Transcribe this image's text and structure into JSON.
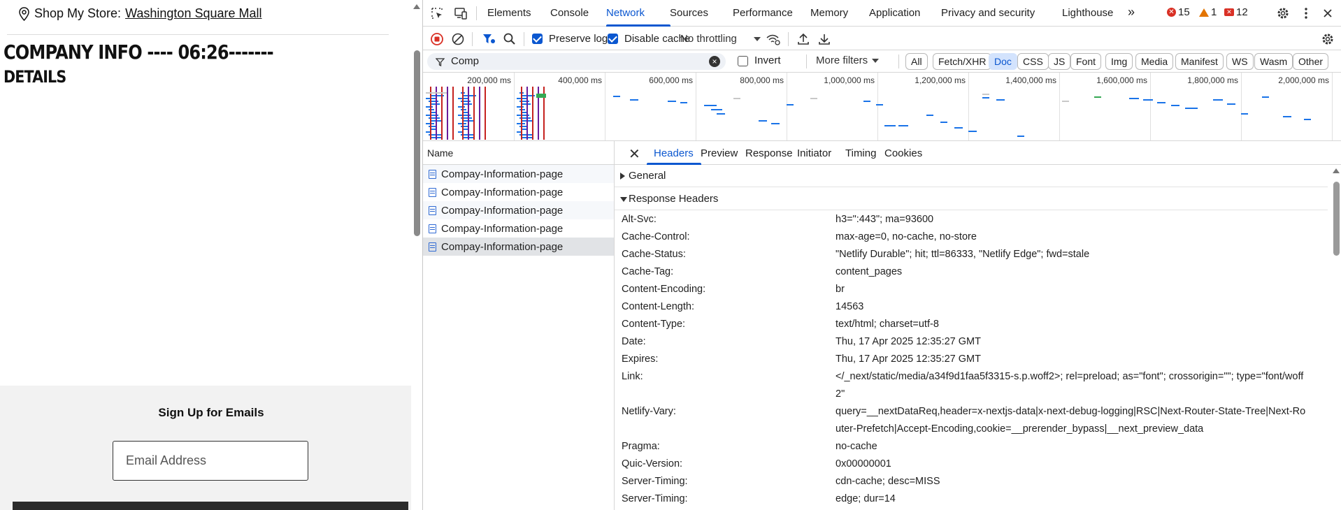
{
  "site": {
    "store_prefix": "Shop My Store: ",
    "store_name": "Washington Square Mall",
    "title": "COMPANY INFO ---- 06:26-------",
    "subtitle": "DETAILS",
    "signup_title": "Sign Up for Emails",
    "email_placeholder": "Email Address"
  },
  "devtools": {
    "tabs": [
      "Elements",
      "Console",
      "Network",
      "Sources",
      "Performance",
      "Memory",
      "Application",
      "Privacy and security",
      "Lighthouse"
    ],
    "active_tab": "Network",
    "more_tabs": "»",
    "errors": "15",
    "warnings": "1",
    "issues": "12",
    "toolbar": {
      "preserve_log": "Preserve log",
      "disable_cache": "Disable cache",
      "throttling": "No throttling"
    },
    "filter": {
      "value": "Comp",
      "invert": "Invert",
      "more_filters": "More filters",
      "types": [
        "All",
        "Fetch/XHR",
        "Doc",
        "CSS",
        "JS",
        "Font",
        "Img",
        "Media",
        "Manifest",
        "WS",
        "Wasm",
        "Other"
      ],
      "active_type": "Doc"
    },
    "overview_ticks": [
      "200,000 ms",
      "400,000 ms",
      "600,000 ms",
      "800,000 ms",
      "1,000,000 ms",
      "1,200,000 ms",
      "1,400,000 ms",
      "1,600,000 ms",
      "1,800,000 ms",
      "2,000,000 ms"
    ],
    "list": {
      "header": "Name",
      "rows": [
        "Compay-Information-page",
        "Compay-Information-page",
        "Compay-Information-page",
        "Compay-Information-page",
        "Compay-Information-page"
      ],
      "selected_index": 4
    },
    "detail": {
      "tabs": [
        "Headers",
        "Preview",
        "Response",
        "Initiator",
        "Timing",
        "Cookies"
      ],
      "active_tab": "Headers",
      "general": "General",
      "response_headers": "Response Headers",
      "headers": [
        {
          "name": "Alt-Svc:",
          "value": "h3=\":443\"; ma=93600"
        },
        {
          "name": "Cache-Control:",
          "value": "max-age=0, no-cache, no-store"
        },
        {
          "name": "Cache-Status:",
          "value": "\"Netlify Durable\"; hit; ttl=86333, \"Netlify Edge\"; fwd=stale"
        },
        {
          "name": "Cache-Tag:",
          "value": "content_pages"
        },
        {
          "name": "Content-Encoding:",
          "value": "br"
        },
        {
          "name": "Content-Length:",
          "value": "14563"
        },
        {
          "name": "Content-Type:",
          "value": "text/html; charset=utf-8"
        },
        {
          "name": "Date:",
          "value": "Thu, 17 Apr 2025 12:35:27 GMT"
        },
        {
          "name": "Expires:",
          "value": "Thu, 17 Apr 2025 12:35:27 GMT"
        },
        {
          "name": "Link:",
          "value": "</_next/static/media/a34f9d1faa5f3315-s.p.woff2>; rel=preload; as=\"font\"; crossorigin=\"\"; type=\"font/woff2\""
        },
        {
          "name": "Netlify-Vary:",
          "value": "query=__nextDataReq,header=x-nextjs-data|x-next-debug-logging|RSC|Next-Router-State-Tree|Next-Router-Prefetch|Accept-Encoding,cookie=__prerender_bypass|__next_preview_data"
        },
        {
          "name": "Pragma:",
          "value": "no-cache"
        },
        {
          "name": "Quic-Version:",
          "value": "0x00000001"
        },
        {
          "name": "Server-Timing:",
          "value": "cdn-cache; desc=MISS"
        },
        {
          "name": "Server-Timing:",
          "value": "edge; dur=14"
        }
      ]
    }
  }
}
